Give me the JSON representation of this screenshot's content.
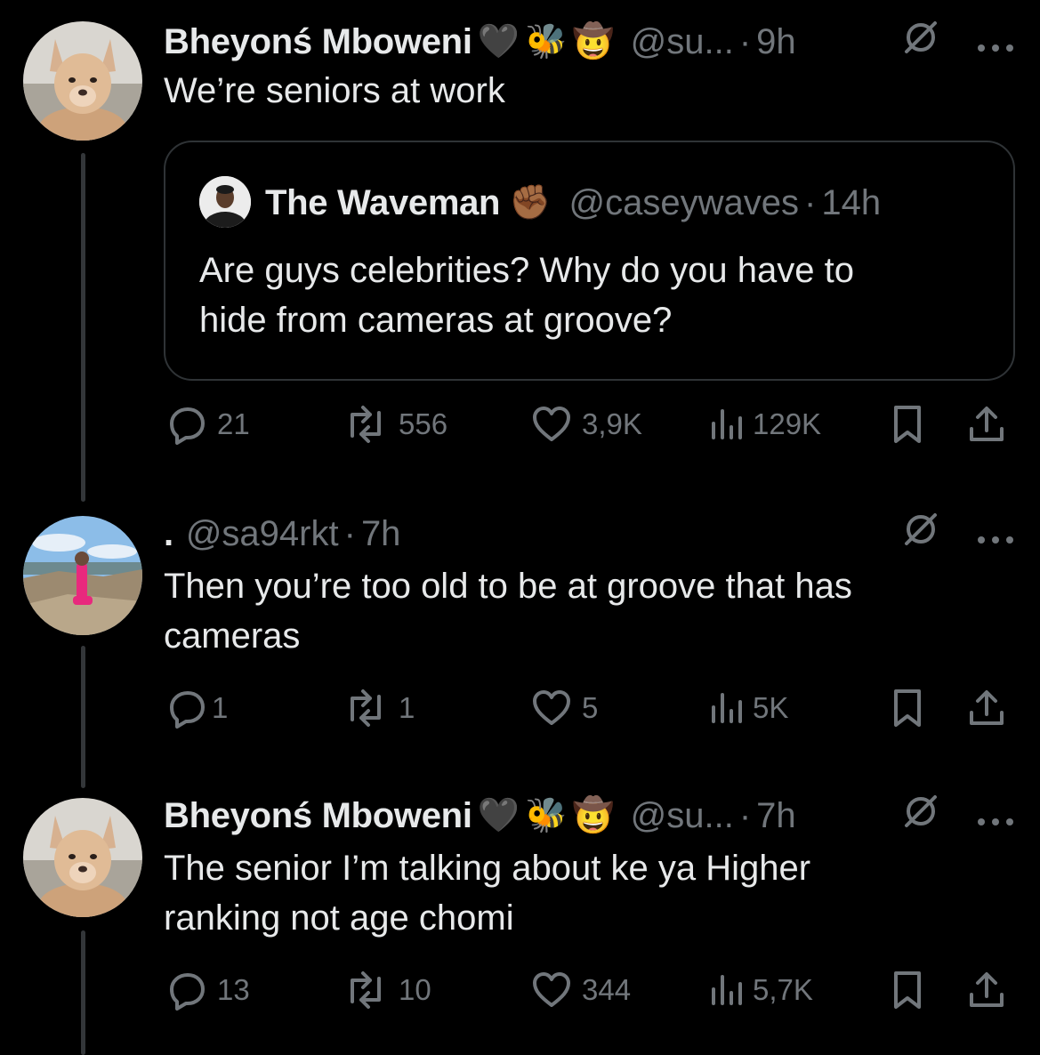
{
  "tweets": [
    {
      "name": "Bheyonś Mboweni",
      "emojis": [
        "🖤",
        "🐝",
        "🤠"
      ],
      "handle": "@su...",
      "time": "9h",
      "text": "We’re seniors at work",
      "quote": {
        "name": "The Waveman",
        "emoji": "✊🏾",
        "handle": "@caseywaves",
        "time": "14h",
        "text": "Are guys celebrities? Why do you have to\nhide from cameras at groove?"
      },
      "stats": {
        "replies": "21",
        "reposts": "556",
        "likes": "3,9K",
        "views": "129K"
      }
    },
    {
      "name": ".",
      "handle": "@sa94rkt",
      "time": "7h",
      "text": "Then you’re too old to be at groove that has\ncameras",
      "stats": {
        "replies": "1",
        "reposts": "1",
        "likes": "5",
        "views": "5K"
      }
    },
    {
      "name": "Bheyonś Mboweni",
      "emojis": [
        "🖤",
        "🐝",
        "🤠"
      ],
      "handle": "@su...",
      "time": "7h",
      "text": "The senior I’m talking about ke ya Higher\nranking not age chomi",
      "stats": {
        "replies": "13",
        "reposts": "10",
        "likes": "344",
        "views": "5,7K"
      }
    }
  ],
  "icons": {
    "reply": "reply-icon",
    "repost": "repost-icon",
    "like": "heart-icon",
    "views": "views-icon",
    "bookmark": "bookmark-icon",
    "share": "share-icon",
    "grok": "grok-icon",
    "more": "more-icon"
  },
  "colors": {
    "background": "#000000",
    "text": "#e7e9ea",
    "muted": "#71767b",
    "border": "#2f3336"
  }
}
